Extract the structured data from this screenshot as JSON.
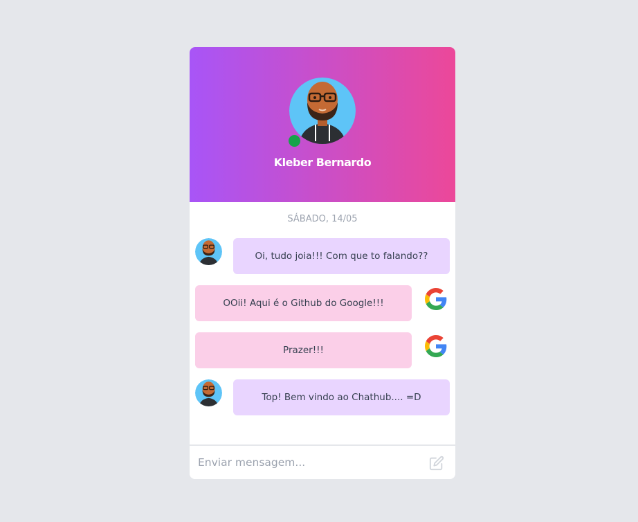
{
  "header": {
    "name": "Kleber Bernardo",
    "online": true
  },
  "chat": {
    "date": "SÁBADO, 14/05",
    "messages": [
      {
        "from": "contact",
        "text": "Oi, tudo joia!!! Com que to falando??"
      },
      {
        "from": "self",
        "text": "OOii! Aqui é o Github do Google!!!"
      },
      {
        "from": "self",
        "text": "Prazer!!!"
      },
      {
        "from": "contact",
        "text": "Top! Bem vindo ao Chathub.... =D"
      }
    ]
  },
  "composer": {
    "placeholder": "Enviar mensagem..."
  },
  "colors": {
    "gradient_start": "#a855f7",
    "gradient_end": "#ec4899",
    "incoming_bubble": "#e9d5ff",
    "outgoing_bubble": "#fbcfe8",
    "online": "#16a34a"
  },
  "icons": {
    "contact_avatar": "avatar-icon",
    "self_avatar": "google-icon",
    "send": "edit-icon"
  }
}
